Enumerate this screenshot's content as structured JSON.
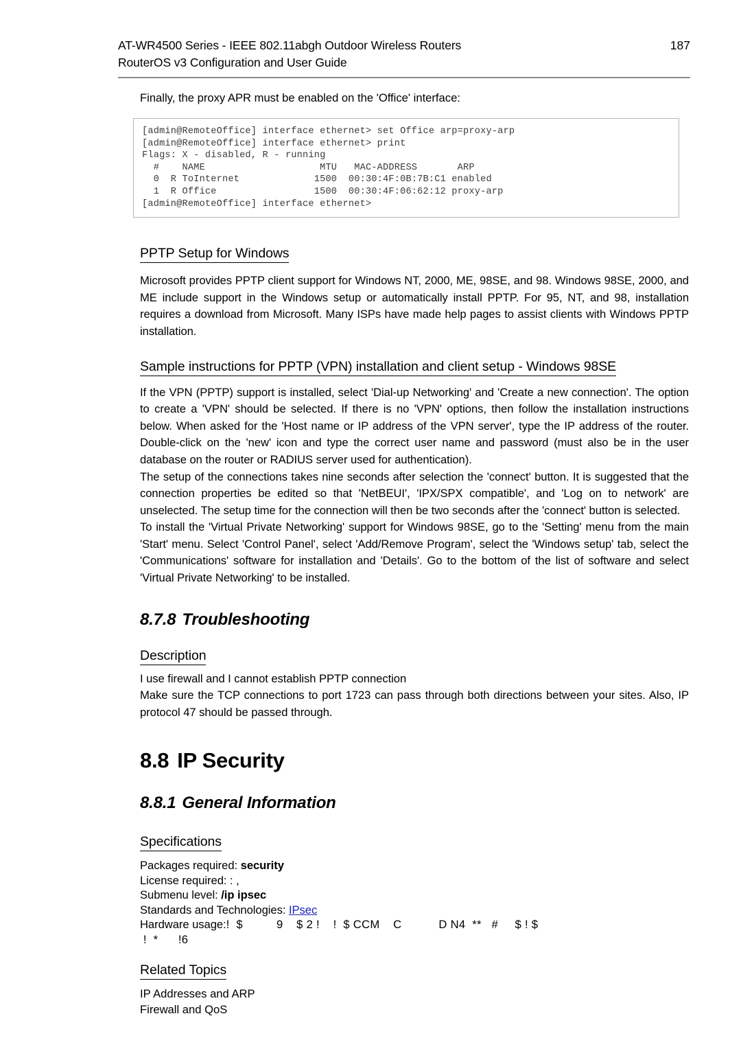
{
  "header": {
    "title": "AT-WR4500 Series - IEEE 802.11abgh Outdoor Wireless Routers",
    "subtitle": "RouterOS v3 Configuration and User Guide",
    "page_number": "187"
  },
  "intro": {
    "lead": "Finally, the proxy APR must be enabled on the 'Office' interface:"
  },
  "code_block": {
    "text": "[admin@RemoteOffice] interface ethernet> set Office arp=proxy-arp\n[admin@RemoteOffice] interface ethernet> print\nFlags: X - disabled, R - running\n  #    NAME                    MTU   MAC-ADDRESS       ARP\n  0  R ToInternet             1500  00:30:4F:0B:7B:C1 enabled\n  1  R Office                 1500  00:30:4F:06:62:12 proxy-arp\n[admin@RemoteOffice] interface ethernet>"
  },
  "pptp_setup": {
    "heading": "PPTP Setup for Windows",
    "paragraph": "Microsoft provides PPTP client support for Windows NT, 2000, ME, 98SE, and 98. Windows 98SE, 2000, and ME include support in the Windows setup or automatically install PPTP. For 95, NT, and 98, installation requires a download from Microsoft. Many ISPs have made help pages to assist clients with Windows PPTP installation."
  },
  "sample_instructions": {
    "heading": "Sample instructions for PPTP (VPN) installation and client setup - Windows 98SE",
    "paragraph_1": "If the VPN (PPTP) support is installed, select 'Dial-up Networking' and 'Create a new connection'. The option to create a 'VPN' should be selected. If there is no 'VPN' options, then follow the installation instructions below. When asked for the 'Host name or IP address of the VPN server', type the IP address of the router. Double-click on the 'new' icon and type the correct user name and password (must also be in the user database on the router or RADIUS server used for authentication).",
    "paragraph_2": "The setup of the connections takes nine seconds after selection the 'connect' button. It is suggested that the connection properties be edited so that 'NetBEUI', 'IPX/SPX compatible', and 'Log on to network' are unselected. The setup time for the connection will then be two seconds after the 'connect' button is selected.",
    "paragraph_3": "To install the 'Virtual Private Networking' support for Windows 98SE, go to the 'Setting' menu from the main 'Start' menu. Select 'Control Panel', select 'Add/Remove Program', select the 'Windows setup' tab, select the 'Communications' software for installation and 'Details'. Go to the bottom of the list of software and select 'Virtual Private Networking' to be installed."
  },
  "troubleshooting": {
    "number": "8.7.8",
    "title": "Troubleshooting",
    "description_heading": "Description",
    "line_1": "I use firewall and I cannot establish PPTP connection",
    "line_2": "Make sure the TCP connections to port 1723 can pass through both directions between your sites. Also, IP protocol 47 should be passed through."
  },
  "ip_security": {
    "number": "8.8",
    "title": "IP Security",
    "general_info": {
      "number": "8.8.1",
      "title": "General Information"
    },
    "specifications": {
      "heading": "Specifications",
      "packages_label": "Packages required:",
      "packages_value": "security",
      "license_label": "License required:",
      "license_value": ": ,",
      "submenu_label": "Submenu level:",
      "submenu_value": "/ip ipsec",
      "standards_label": "Standards and Technologies:",
      "standards_link": "IPsec",
      "hardware_label": "Hardware usage:",
      "hardware_value": "!  $          9    $ 2 !    !  $ CCM    C           D N4  **   #     $ ! $",
      "hardware_value_2": " !  *      !6"
    },
    "related_topics": {
      "heading": "Related Topics",
      "items": [
        "IP Addresses and ARP",
        "Firewall and QoS"
      ]
    }
  }
}
